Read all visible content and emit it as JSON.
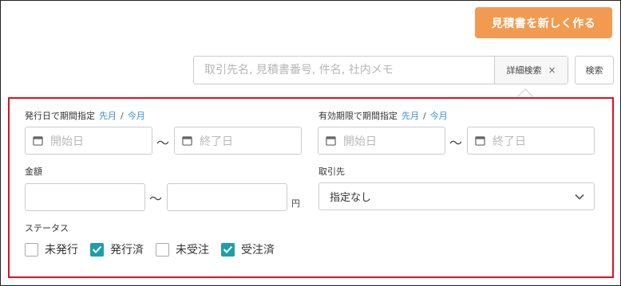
{
  "header": {
    "create_button_label": "見積書を新しく作る"
  },
  "search": {
    "placeholder": "取引先名, 見積書番号, 件名, 社内メモ",
    "advanced_label": "詳細検索",
    "advanced_close": "×",
    "search_button_label": "検索"
  },
  "filters": {
    "issue_date": {
      "label": "発行日で期間指定",
      "last_month": "先月",
      "separator": "/",
      "this_month": "今月",
      "start_placeholder": "開始日",
      "end_placeholder": "終了日",
      "range_separator": "〜"
    },
    "expiry_date": {
      "label": "有効期限で期間指定",
      "last_month": "先月",
      "separator": "/",
      "this_month": "今月",
      "start_placeholder": "開始日",
      "end_placeholder": "終了日",
      "range_separator": "〜"
    },
    "amount": {
      "label": "金額",
      "min_value": "",
      "max_value": "",
      "range_separator": "〜",
      "unit": "円"
    },
    "client": {
      "label": "取引先",
      "selected": "指定なし"
    },
    "status": {
      "label": "ステータス",
      "options": [
        {
          "label": "未発行",
          "checked": false
        },
        {
          "label": "発行済",
          "checked": true
        },
        {
          "label": "未受注",
          "checked": false
        },
        {
          "label": "受注済",
          "checked": true
        }
      ]
    }
  },
  "colors": {
    "accent": "#f29b50",
    "link": "#3a8fd6",
    "checkbox": "#1e9eab",
    "highlight_border": "#e01020"
  },
  "icons": {
    "calendar": "calendar-icon",
    "chevron": "chevron-down-icon",
    "check": "check-icon"
  }
}
